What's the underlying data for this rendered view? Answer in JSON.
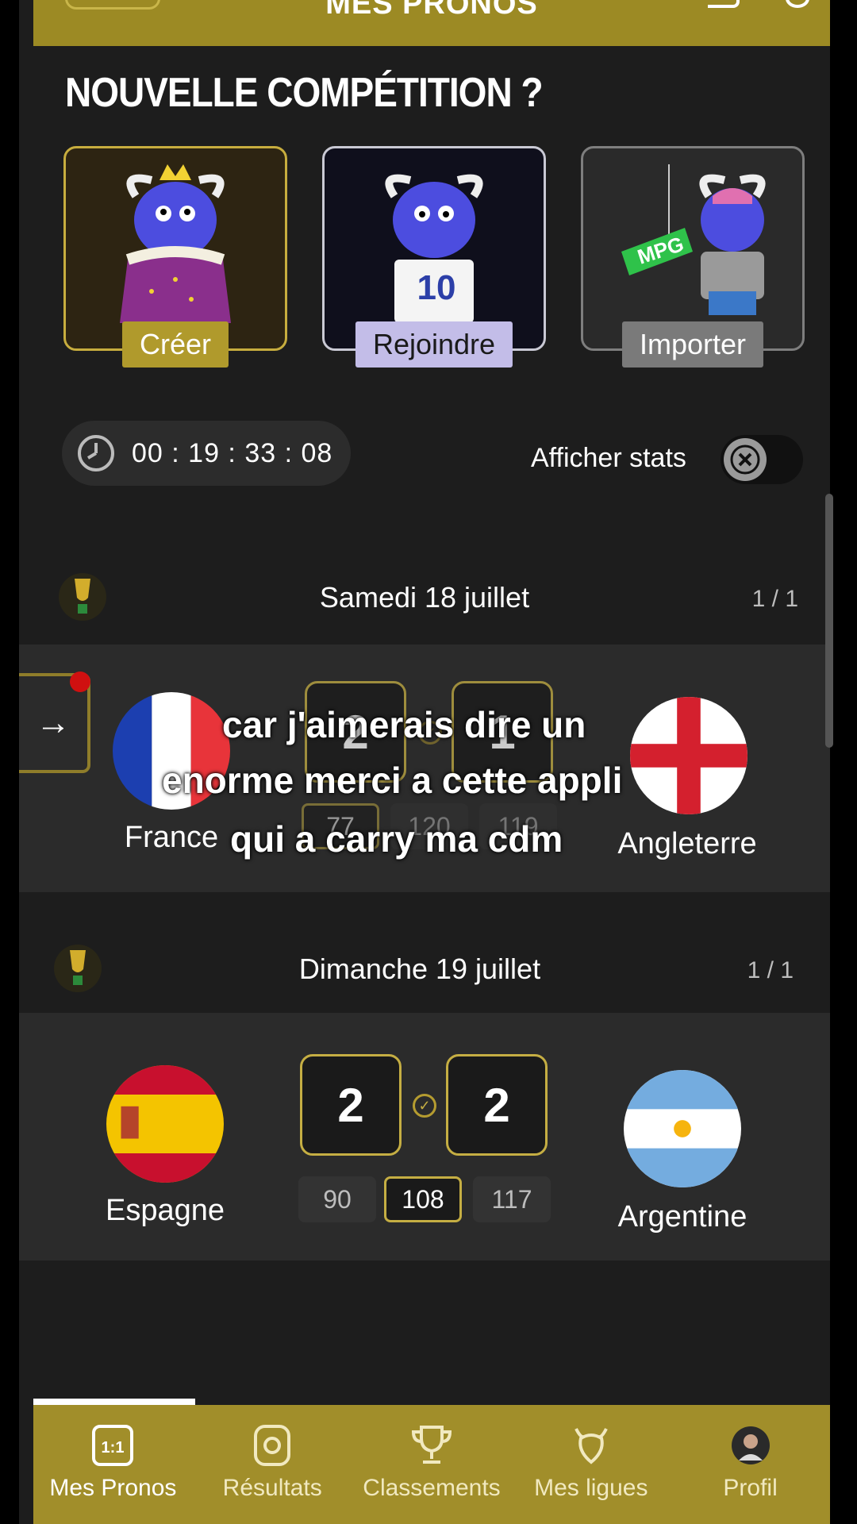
{
  "header": {
    "title": "MES PRONOS"
  },
  "section_title": "NOUVELLE COMPÉTITION ?",
  "cards": {
    "create_label": "Créer",
    "join_label": "Rejoindre",
    "import_label": "Importer",
    "jersey_number": "10",
    "mpg_tag": "MPG"
  },
  "timer": {
    "value": "00 : 19 : 33 : 08"
  },
  "stats": {
    "label": "Afficher stats",
    "enabled": false
  },
  "matches": [
    {
      "day": "Samedi 18 juillet",
      "count": "1 / 1",
      "home": "France",
      "away": "Angleterre",
      "home_score": "2",
      "away_score": "1",
      "odds": [
        "77",
        "120",
        "119"
      ]
    },
    {
      "day": "Dimanche 19 juillet",
      "count": "1 / 1",
      "home": "Espagne",
      "away": "Argentine",
      "home_score": "2",
      "away_score": "2",
      "odds": [
        "90",
        "108",
        "117"
      ]
    }
  ],
  "caption": {
    "line1": "car j'aimerais dire un",
    "line2": "enorme merci a cette appli",
    "line3": "qui a carry ma cdm"
  },
  "nav": {
    "items": [
      {
        "label": "Mes Pronos",
        "icon": "one-one-icon"
      },
      {
        "label": "Résultats",
        "icon": "badge-icon"
      },
      {
        "label": "Classements",
        "icon": "trophy-icon"
      },
      {
        "label": "Mes ligues",
        "icon": "goat-icon"
      },
      {
        "label": "Profil",
        "icon": "avatar"
      }
    ],
    "badge_text": "1:1"
  },
  "colors": {
    "accent": "#a18e2a",
    "background": "#1d1d1d",
    "card_bg": "#2b2b2b"
  }
}
